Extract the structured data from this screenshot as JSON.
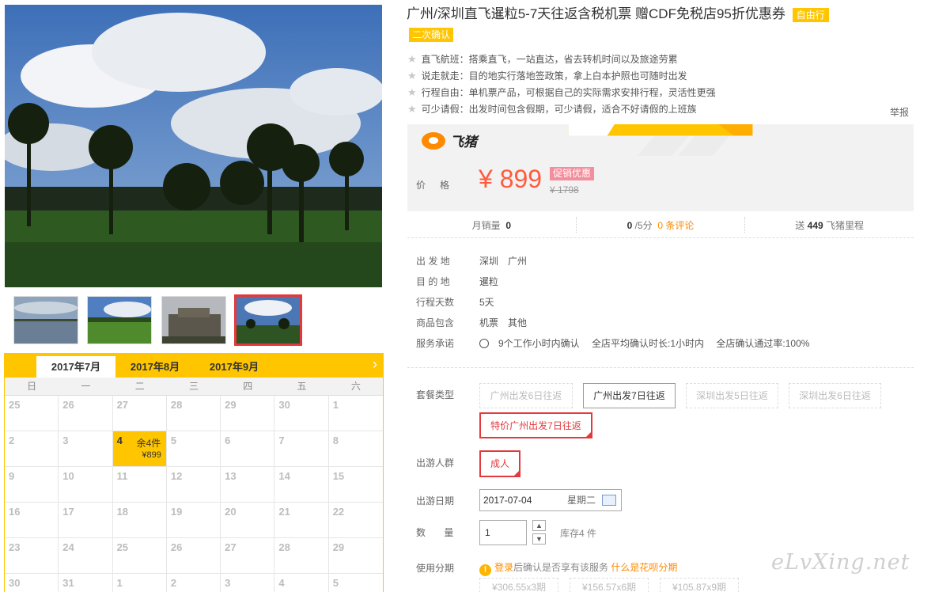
{
  "product": {
    "title": "广州/深圳直飞暹粒5-7天往返含税机票 赠CDF免税店95折优惠券",
    "tag_freetrip": "自由行",
    "tag_confirm": "二次确认",
    "features": [
      "直飞航班：搭乘直飞，一站直达，省去转机时间以及旅途劳累",
      "说走就走：目的地实行落地签政策，拿上白本护照也可随时出发",
      "行程自由：单机票产品，可根据自己的实际需求安排行程，灵活性更强",
      "可少请假：出发时间包含假期，可少请假，适合不好请假的上班族"
    ],
    "report": "举报"
  },
  "price": {
    "brand": "飞猪",
    "label": "价格",
    "current": "¥ 899",
    "promo": "促销优惠",
    "original": "¥ 1798"
  },
  "stats": {
    "monthly_label": "月销量",
    "monthly_value": "0",
    "score_value": "0",
    "score_suffix": "/5分",
    "reviews": "0 条评论",
    "mileage_prefix": "送",
    "mileage_value": "449",
    "mileage_suffix": "飞猪里程"
  },
  "info": {
    "depart_label": "出 发 地",
    "depart_values": [
      "深圳",
      "广州"
    ],
    "dest_label": "目 的 地",
    "dest_value": "暹粒",
    "days_label": "行程天数",
    "days_value": "5天",
    "includes_label": "商品包含",
    "includes_values": [
      "机票",
      "其他"
    ],
    "promise_label": "服务承诺",
    "promise_values": [
      "9个工作小时内确认",
      "全店平均确认时长:1小时内",
      "全店确认通过率:100%"
    ]
  },
  "options": {
    "package_label": "套餐类型",
    "packages": [
      "广州出发6日往返",
      "广州出发7日往返",
      "深圳出发5日往返",
      "深圳出发6日往返",
      "特价广州出发7日往返"
    ],
    "people_label": "出游人群",
    "people": "成人",
    "date_label": "出游日期",
    "date_value": "2017-07-04",
    "date_weekday": "星期二",
    "qty_label": "数 量",
    "qty_value": "1",
    "stock": "库存4 件",
    "installment_label": "使用分期",
    "installment_login": "登录",
    "installment_text": "后确认是否享有该服务",
    "installment_link": "什么是花呗分期",
    "installment_options": [
      "¥306.55x3期",
      "¥156.57x6期",
      "¥105.87x9期"
    ]
  },
  "calendar": {
    "months": [
      "2017年7月",
      "2017年8月",
      "2017年9月"
    ],
    "weekdays": [
      "日",
      "一",
      "二",
      "三",
      "四",
      "五",
      "六"
    ],
    "rows": [
      [
        "25",
        "26",
        "27",
        "28",
        "29",
        "30",
        "1"
      ],
      [
        "2",
        "3",
        "4",
        "5",
        "6",
        "7",
        "8"
      ],
      [
        "9",
        "10",
        "11",
        "12",
        "13",
        "14",
        "15"
      ],
      [
        "16",
        "17",
        "18",
        "19",
        "20",
        "21",
        "22"
      ],
      [
        "23",
        "24",
        "25",
        "26",
        "27",
        "28",
        "29"
      ],
      [
        "30",
        "31",
        "1",
        "2",
        "3",
        "4",
        "5"
      ]
    ],
    "available_day": {
      "day": "4",
      "stock": "余4件",
      "price": "¥899"
    }
  },
  "watermark": "eLvXing.net"
}
